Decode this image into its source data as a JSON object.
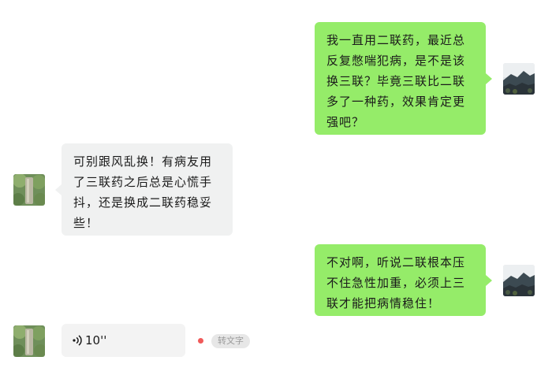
{
  "messages": [
    {
      "sender": "self",
      "text": "我一直用二联药，最近总反复憋喘犯病，是不是该换三联？毕竟三联比二联多了一种药，效果肯定更强吧？"
    },
    {
      "sender": "other",
      "text": "可别跟风乱换！有病友用了三联药之后总是心慌手抖，还是换成二联药稳妥些！"
    },
    {
      "sender": "self",
      "text": "不对啊，听说二联根本压不住急性加重，必须上三联才能把病情稳住！"
    },
    {
      "sender": "other",
      "type": "voice",
      "duration": "10''",
      "unread": true,
      "convert_label": "转文字"
    }
  ],
  "icons": {
    "self_avatar": "mountain-landscape-avatar",
    "other_avatar": "tree-nature-avatar",
    "voice": "voice-wave-icon"
  },
  "colors": {
    "self_bubble": "#95ec69",
    "other_bubble": "#f0f1f1",
    "unread_dot": "#f05a5a"
  }
}
